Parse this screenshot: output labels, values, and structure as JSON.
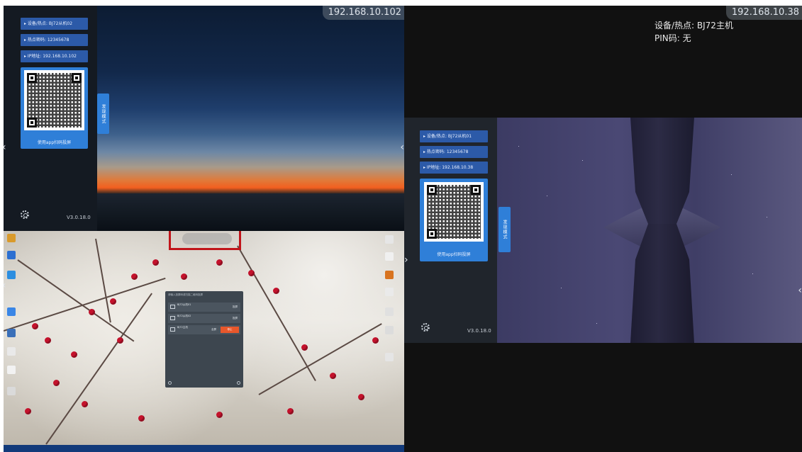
{
  "top_left": {
    "ip": "192.168.10.102",
    "device_label": "设备/热点: BJ72从机02",
    "password_label": "热点密码: 12345678",
    "ip_label": "IP地址: 192.168.10.102",
    "qr_caption": "使用app扫码投屏",
    "mode_tab": "发现模式",
    "version": "V3.0.18.0",
    "settings_icon": "gear-icon"
  },
  "bottom_left": {
    "cast_dialog": {
      "title": "请输入投屏码或扫描二维码投屏",
      "rows": [
        {
          "name": "BJ72从机01",
          "action": "投屏"
        },
        {
          "name": "BJ72从机02",
          "action": "投屏"
        },
        {
          "name": "BJ72主机",
          "action": "全屏",
          "stop": "停止"
        }
      ]
    },
    "highlight_color": "#c1141a"
  },
  "right": {
    "ip": "192.168.10.38",
    "device_info": "设备/热点: BJ72主机",
    "pin_info": "PIN码: 无",
    "panel": {
      "device_label": "设备/热点: BJ72从机01",
      "password_label": "热点密码: 12345678",
      "ip_label": "IP地址: 192.168.10.38",
      "qr_caption": "使用app扫码投屏",
      "mode_tab": "发现模式",
      "version": "V3.0.18.0"
    }
  },
  "colors": {
    "chip_blue": "#2c5aa8",
    "qr_card_blue": "#2f7fd8",
    "stop_orange": "#e8572b",
    "taskbar": "#123a7a"
  }
}
